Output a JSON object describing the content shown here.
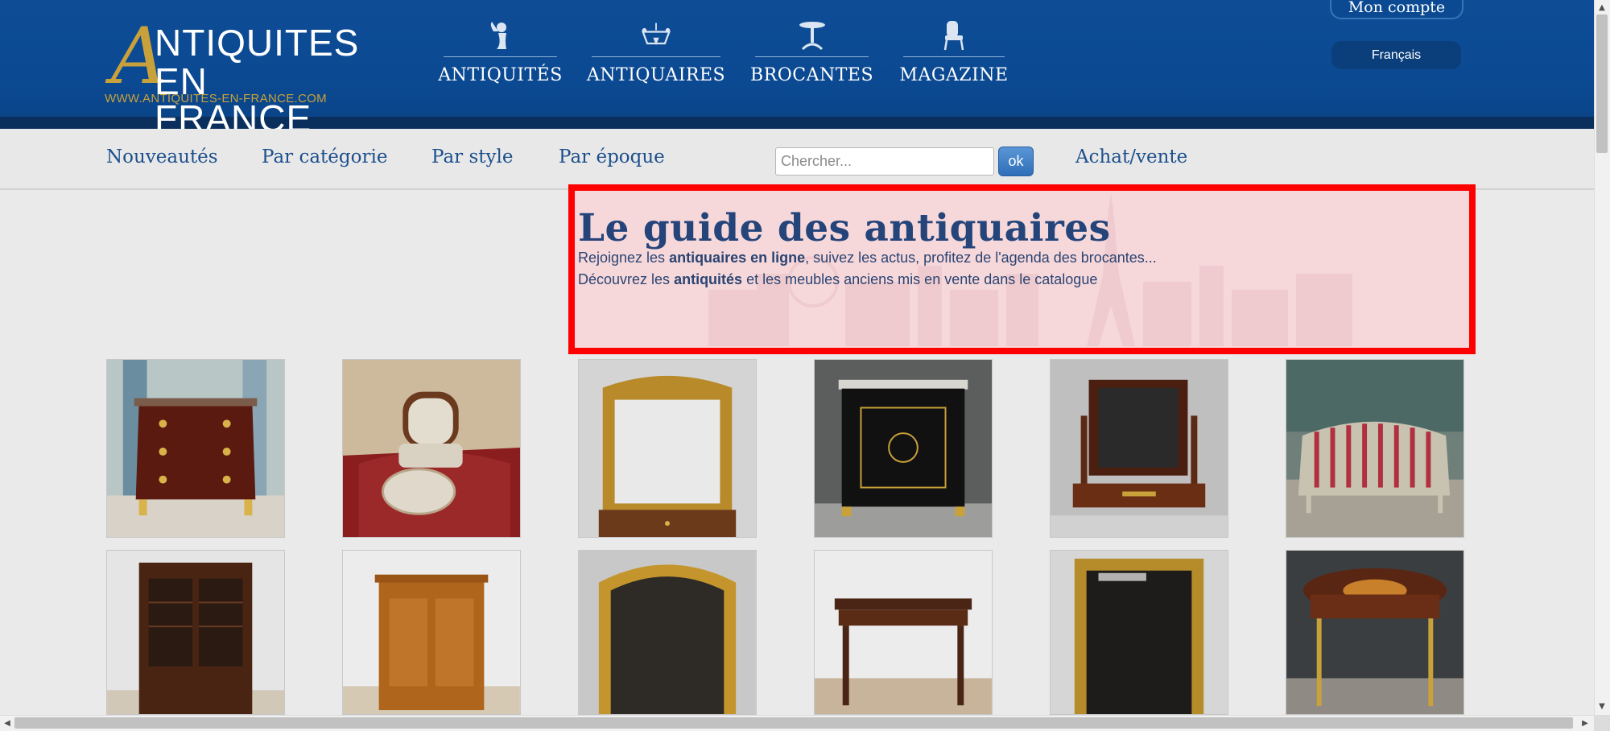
{
  "logo": {
    "letter": "A",
    "line1": "NTIQUITES",
    "line2": "EN FRANCE",
    "url": "WWW.ANTIQUITES-EN-FRANCE.COM"
  },
  "main_nav": [
    {
      "label": "ANTIQUITÉS",
      "icon": "cherub-icon"
    },
    {
      "label": "ANTIQUAIRES",
      "icon": "chandelier-icon"
    },
    {
      "label": "BROCANTES",
      "icon": "pedestal-table-icon"
    },
    {
      "label": "MAGAZINE",
      "icon": "armchair-icon"
    }
  ],
  "account": {
    "label": "Mon compte"
  },
  "language": {
    "label": "Français"
  },
  "subnav": {
    "links": [
      "Nouveautés",
      "Par catégorie",
      "Par style",
      "Par époque"
    ],
    "search_placeholder": "Chercher...",
    "search_button": "ok",
    "achat_vente": "Achat/vente"
  },
  "intro": {
    "title": "Le guide des antiquaires",
    "line1_pre": "Rejoignez les ",
    "line1_bold": "antiquaires en ligne",
    "line1_post": ", suivez les actus, profitez de l'agenda des brocantes...",
    "line2_pre": "Découvrez les ",
    "line2_bold": "antiquités",
    "line2_post": " et les meubles anciens mis en vente dans le catalogue"
  },
  "colors": {
    "header_blue": "#0b4a93",
    "gold": "#c9a13a",
    "link_blue": "#1c4f8c",
    "highlight_red": "#ff0000"
  },
  "products": [
    {
      "name": "commode-louis-xv-image"
    },
    {
      "name": "fauteuil-et-repose-pied-image"
    },
    {
      "name": "miroir-dore-image"
    },
    {
      "name": "meuble-napoleon-iii-boulle-image"
    },
    {
      "name": "miroir-psyche-image"
    },
    {
      "name": "canape-louis-xvi-image"
    },
    {
      "name": "bibliotheque-acajou-image"
    },
    {
      "name": "meuble-bas-pin-image"
    },
    {
      "name": "miroir-dore-arrondi-image"
    },
    {
      "name": "table-bureau-image"
    },
    {
      "name": "grand-miroir-dore-image"
    },
    {
      "name": "bureau-marqueterie-image"
    }
  ]
}
